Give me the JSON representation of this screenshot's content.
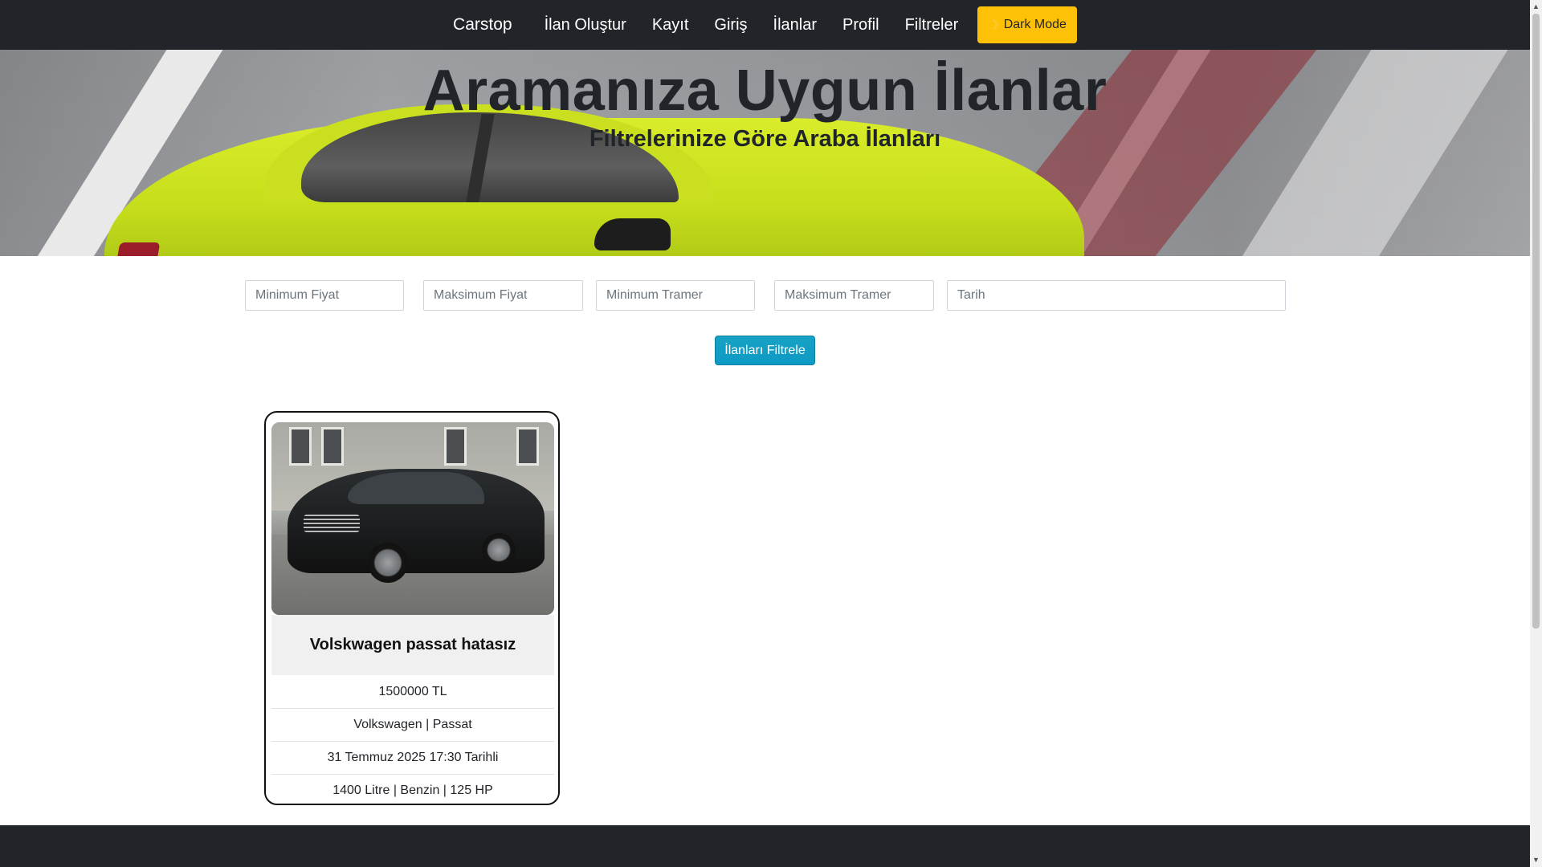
{
  "navbar": {
    "brand": "Carstop",
    "links": [
      "İlan Oluştur",
      "Kayıt",
      "Giriş",
      "İlanlar",
      "Profil",
      "Filtreler"
    ],
    "dark_mode_label": "Dark Mode",
    "dark_mode_icon": "moon-icon",
    "background_color": "#212529",
    "dark_mode_color": "#ffc107"
  },
  "hero": {
    "title": "Aramanıza Uygun İlanlar",
    "subtitle": "Filtrelerinize Göre Araba İlanları"
  },
  "filters": {
    "min_price_placeholder": "Minimum Fiyat",
    "max_price_placeholder": "Maksimum Fiyat",
    "min_tramer_placeholder": "Minimum Tramer",
    "max_tramer_placeholder": "Maksimum Tramer",
    "date_placeholder": "Tarih",
    "submit_label": "İlanları Filtrele",
    "submit_color": "#17a2c4"
  },
  "listings": [
    {
      "title": "Volskwagen passat hatasız",
      "price": "1500000 TL",
      "make_model": "Volkswagen | Passat",
      "date": "31 Temmuz 2025 17:30 Tarihli",
      "specs": "1400 Litre | Benzin | 125 HP"
    }
  ]
}
